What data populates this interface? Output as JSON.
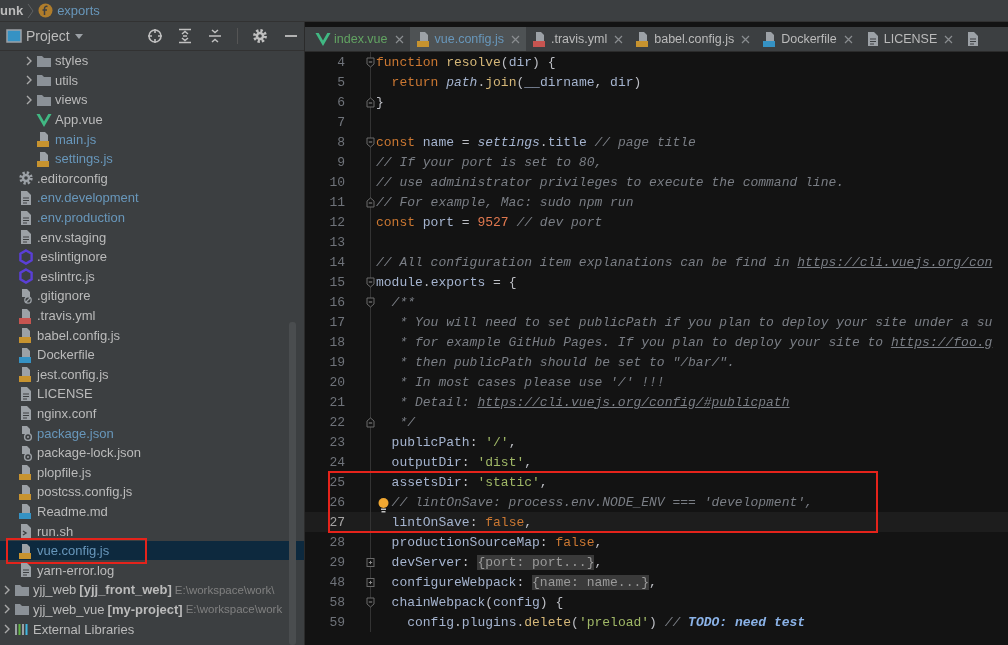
{
  "breadcrumb": [
    {
      "label": "unk",
      "kind": "text"
    },
    {
      "label": "exports",
      "kind": "function"
    }
  ],
  "project_panel": {
    "title": "Project",
    "tree": [
      {
        "children": [
          {
            "children": [
              {
                "label": "styles",
                "kind": "folder",
                "modified": false,
                "expanded": false,
                "selected": false,
                "annotated": false
              },
              {
                "label": "utils",
                "kind": "folder",
                "modified": false,
                "expanded": false,
                "selected": false,
                "annotated": false
              },
              {
                "label": "views",
                "kind": "folder",
                "modified": false,
                "expanded": false,
                "selected": false,
                "annotated": false
              },
              {
                "label": "App.vue",
                "kind": "vue",
                "modified": false,
                "selected": false,
                "annotated": false
              },
              {
                "label": "main.js",
                "kind": "js",
                "modified": true,
                "selected": false,
                "annotated": false
              },
              {
                "label": "settings.js",
                "kind": "js",
                "modified": true,
                "selected": false,
                "annotated": false
              }
            ]
          },
          {
            "label": ".editorconfig",
            "kind": "gear",
            "modified": false,
            "selected": false,
            "annotated": false
          },
          {
            "label": ".env.development",
            "kind": "plain",
            "modified": true,
            "selected": false,
            "annotated": false
          },
          {
            "label": ".env.production",
            "kind": "plain",
            "modified": true,
            "selected": false,
            "annotated": false
          },
          {
            "label": ".env.staging",
            "kind": "plain",
            "modified": false,
            "selected": false,
            "annotated": false
          },
          {
            "label": ".eslintignore",
            "kind": "eslint",
            "modified": false,
            "selected": false,
            "annotated": false
          },
          {
            "label": ".eslintrc.js",
            "kind": "eslint",
            "modified": false,
            "selected": false,
            "annotated": false
          },
          {
            "label": ".gitignore",
            "kind": "ignore",
            "modified": false,
            "selected": false,
            "annotated": false
          },
          {
            "label": ".travis.yml",
            "kind": "yml",
            "modified": false,
            "selected": false,
            "annotated": false
          },
          {
            "label": "babel.config.js",
            "kind": "js",
            "modified": false,
            "selected": false,
            "annotated": false
          },
          {
            "label": "Dockerfile",
            "kind": "docker",
            "modified": false,
            "selected": false,
            "annotated": false
          },
          {
            "label": "jest.config.js",
            "kind": "js",
            "modified": false,
            "selected": false,
            "annotated": false
          },
          {
            "label": "LICENSE",
            "kind": "plain",
            "modified": false,
            "selected": false,
            "annotated": false
          },
          {
            "label": "nginx.conf",
            "kind": "plain",
            "modified": false,
            "selected": false,
            "annotated": false
          },
          {
            "label": "package.json",
            "kind": "json",
            "modified": true,
            "selected": false,
            "annotated": false
          },
          {
            "label": "package-lock.json",
            "kind": "json",
            "modified": false,
            "selected": false,
            "annotated": false
          },
          {
            "label": "plopfile.js",
            "kind": "js",
            "modified": false,
            "selected": false,
            "annotated": false
          },
          {
            "label": "postcss.config.js",
            "kind": "js",
            "modified": false,
            "selected": false,
            "annotated": false
          },
          {
            "label": "Readme.md",
            "kind": "md",
            "modified": false,
            "selected": false,
            "annotated": false
          },
          {
            "label": "run.sh",
            "kind": "sh",
            "modified": false,
            "selected": false,
            "annotated": false
          },
          {
            "label": "vue.config.js",
            "kind": "js",
            "modified": true,
            "selected": true,
            "annotated": true
          },
          {
            "label": "yarn-error.log",
            "kind": "plain",
            "modified": false,
            "selected": false,
            "annotated": false
          }
        ]
      },
      {
        "label": "yjj_web",
        "module": "[yjj_front_web]",
        "path": "E:\\workspace\\work\\",
        "kind": "folder",
        "modified": false,
        "expanded": false,
        "selected": false,
        "annotated": false
      },
      {
        "label": "yjj_web_vue",
        "module": "[my-project]",
        "path": "E:\\workspace\\work",
        "kind": "folder",
        "modified": false,
        "expanded": false,
        "selected": false,
        "annotated": false
      },
      {
        "label": "External Libraries",
        "kind": "libraries",
        "modified": false,
        "expanded": false,
        "selected": false,
        "annotated": false
      }
    ]
  },
  "editor": {
    "tabs": [
      {
        "label": "index.vue",
        "kind": "vue",
        "added": true,
        "modified": false,
        "selected": false
      },
      {
        "label": "vue.config.js",
        "kind": "js",
        "added": false,
        "modified": true,
        "selected": true
      },
      {
        "label": ".travis.yml",
        "kind": "yml",
        "added": false,
        "modified": false,
        "selected": false
      },
      {
        "label": "babel.config.js",
        "kind": "js",
        "added": false,
        "modified": false,
        "selected": false
      },
      {
        "label": "Dockerfile",
        "kind": "docker",
        "added": false,
        "modified": false,
        "selected": false
      },
      {
        "label": "LICENSE",
        "kind": "plain",
        "added": false,
        "modified": false,
        "selected": false
      },
      {
        "kind": "plain",
        "selected": false
      }
    ],
    "lines": [
      {
        "number": "4",
        "fold": {
          "kind": "start"
        },
        "current": false,
        "annotated": false,
        "tokens": [
          {
            "kind": "kw",
            "text": "function "
          },
          {
            "kind": "fn",
            "text": "resolve"
          },
          {
            "kind": "p",
            "text": "("
          },
          {
            "kind": "id",
            "text": "dir"
          },
          {
            "kind": "p",
            "text": ") {"
          }
        ]
      },
      {
        "number": "5",
        "current": false,
        "annotated": false,
        "tokens": [
          {
            "kind": "kw",
            "text": "  return "
          },
          {
            "kind": "global",
            "text": "path"
          },
          {
            "kind": "p",
            "text": "."
          },
          {
            "kind": "fn",
            "text": "join"
          },
          {
            "kind": "p",
            "text": "("
          },
          {
            "kind": "id",
            "text": "__dirname"
          },
          {
            "kind": "p",
            "text": ", "
          },
          {
            "kind": "id",
            "text": "dir"
          },
          {
            "kind": "p",
            "text": ")"
          }
        ]
      },
      {
        "number": "6",
        "fold": {
          "kind": "end"
        },
        "current": false,
        "annotated": false,
        "tokens": [
          {
            "kind": "p",
            "text": "}"
          }
        ]
      },
      {
        "number": "7",
        "current": false,
        "annotated": false
      },
      {
        "number": "8",
        "fold": {
          "kind": "start"
        },
        "current": false,
        "annotated": false,
        "tokens": [
          {
            "kind": "kw",
            "text": "const "
          },
          {
            "kind": "id",
            "text": "name"
          },
          {
            "kind": "p",
            "text": " = "
          },
          {
            "kind": "global",
            "text": "settings"
          },
          {
            "kind": "p",
            "text": "."
          },
          {
            "kind": "id",
            "text": "title"
          },
          {
            "kind": "c",
            "text": " // page title"
          }
        ]
      },
      {
        "number": "9",
        "current": false,
        "annotated": false,
        "tokens": [
          {
            "kind": "c",
            "text": "// If your port is set to 80,"
          }
        ]
      },
      {
        "number": "10",
        "current": false,
        "annotated": false,
        "tokens": [
          {
            "kind": "c",
            "text": "// use administrator privileges to execute the command line."
          }
        ]
      },
      {
        "number": "11",
        "fold": {
          "kind": "end"
        },
        "current": false,
        "annotated": false,
        "tokens": [
          {
            "kind": "c",
            "text": "// For example, Mac: sudo npm run"
          }
        ]
      },
      {
        "number": "12",
        "current": false,
        "annotated": false,
        "tokens": [
          {
            "kind": "kw",
            "text": "const "
          },
          {
            "kind": "id",
            "text": "port"
          },
          {
            "kind": "p",
            "text": " = "
          },
          {
            "kind": "num",
            "text": "9527"
          },
          {
            "kind": "c",
            "text": " // dev port"
          }
        ]
      },
      {
        "number": "13",
        "current": false,
        "annotated": false
      },
      {
        "number": "14",
        "current": false,
        "annotated": false,
        "tokens": [
          {
            "kind": "c",
            "text": "// All configuration item explanations can be find in "
          },
          {
            "kind": "link",
            "text": "https://cli.vuejs.org/con"
          }
        ]
      },
      {
        "number": "15",
        "fold": {
          "kind": "start"
        },
        "current": false,
        "annotated": false,
        "tokens": [
          {
            "kind": "id",
            "text": "module"
          },
          {
            "kind": "p",
            "text": "."
          },
          {
            "kind": "id",
            "text": "exports"
          },
          {
            "kind": "p",
            "text": " = {"
          }
        ]
      },
      {
        "number": "16",
        "fold": {
          "kind": "start"
        },
        "current": false,
        "annotated": false,
        "tokens": [
          {
            "kind": "c",
            "text": "  /**"
          }
        ]
      },
      {
        "number": "17",
        "current": false,
        "annotated": false,
        "tokens": [
          {
            "kind": "c",
            "text": "   * You will need to set publicPath if you plan to deploy your site under a su"
          }
        ]
      },
      {
        "number": "18",
        "current": false,
        "annotated": false,
        "tokens": [
          {
            "kind": "c",
            "text": "   * for example GitHub Pages. If you plan to deploy your site to "
          },
          {
            "kind": "link",
            "text": "https://foo.g"
          }
        ]
      },
      {
        "number": "19",
        "current": false,
        "annotated": false,
        "tokens": [
          {
            "kind": "c",
            "text": "   * then publicPath should be set to \"/bar/\"."
          }
        ]
      },
      {
        "number": "20",
        "current": false,
        "annotated": false,
        "tokens": [
          {
            "kind": "c",
            "text": "   * In most cases please use '/' !!!"
          }
        ]
      },
      {
        "number": "21",
        "current": false,
        "annotated": false,
        "tokens": [
          {
            "kind": "c",
            "text": "   * Detail: "
          },
          {
            "kind": "link",
            "text": "https://cli.vuejs.org/config/#publicpath"
          }
        ]
      },
      {
        "number": "22",
        "fold": {
          "kind": "end"
        },
        "current": false,
        "annotated": false,
        "tokens": [
          {
            "kind": "c",
            "text": "   */"
          }
        ]
      },
      {
        "number": "23",
        "current": false,
        "annotated": false,
        "tokens": [
          {
            "kind": "id",
            "text": "  publicPath"
          },
          {
            "kind": "p",
            "text": ": "
          },
          {
            "kind": "str",
            "text": "'/'"
          },
          {
            "kind": "p",
            "text": ","
          }
        ]
      },
      {
        "number": "24",
        "current": false,
        "annotated": false,
        "tokens": [
          {
            "kind": "id",
            "text": "  outputDir"
          },
          {
            "kind": "p",
            "text": ": "
          },
          {
            "kind": "str",
            "text": "'dist'"
          },
          {
            "kind": "p",
            "text": ","
          }
        ]
      },
      {
        "number": "25",
        "current": false,
        "annotated": true,
        "tokens": [
          {
            "kind": "id",
            "text": "  assetsDir"
          },
          {
            "kind": "p",
            "text": ": "
          },
          {
            "kind": "str",
            "text": "'static'"
          },
          {
            "kind": "p",
            "text": ","
          }
        ]
      },
      {
        "number": "26",
        "current": false,
        "annotated": true,
        "bulb": true,
        "tokens": [
          {
            "kind": "c",
            "text": "  // lintOnSave: process.env.NODE_ENV === 'development',"
          }
        ]
      },
      {
        "number": "27",
        "current": true,
        "annotated": true,
        "tokens": [
          {
            "kind": "id",
            "text": "  lintOnSave"
          },
          {
            "kind": "p",
            "text": ": "
          },
          {
            "kind": "kw",
            "text": "false"
          },
          {
            "kind": "p",
            "text": ","
          }
        ]
      },
      {
        "number": "28",
        "current": false,
        "annotated": false,
        "tokens": [
          {
            "kind": "id",
            "text": "  productionSourceMap"
          },
          {
            "kind": "p",
            "text": ": "
          },
          {
            "kind": "kw",
            "text": "false"
          },
          {
            "kind": "p",
            "text": ","
          }
        ]
      },
      {
        "number": "29",
        "fold": {
          "kind": "collapsed"
        },
        "current": false,
        "annotated": false,
        "tokens": [
          {
            "kind": "id",
            "text": "  devServer"
          },
          {
            "kind": "p",
            "text": ": "
          },
          {
            "kind": "folded",
            "text": "{port: port...}"
          },
          {
            "kind": "p",
            "text": ","
          }
        ]
      },
      {
        "number": "48",
        "fold": {
          "kind": "collapsed"
        },
        "current": false,
        "annotated": false,
        "tokens": [
          {
            "kind": "id",
            "text": "  configureWebpack"
          },
          {
            "kind": "p",
            "text": ": "
          },
          {
            "kind": "folded",
            "text": "{name: name...}"
          },
          {
            "kind": "p",
            "text": ","
          }
        ]
      },
      {
        "number": "58",
        "fold": {
          "kind": "start"
        },
        "current": false,
        "annotated": false,
        "tokens": [
          {
            "kind": "id",
            "text": "  chainWebpack"
          },
          {
            "kind": "p",
            "text": "("
          },
          {
            "kind": "id",
            "text": "config"
          },
          {
            "kind": "p",
            "text": ") {"
          }
        ]
      },
      {
        "number": "59",
        "current": false,
        "annotated": false,
        "tokens": [
          {
            "kind": "id",
            "text": "    config"
          },
          {
            "kind": "p",
            "text": "."
          },
          {
            "kind": "id",
            "text": "plugins"
          },
          {
            "kind": "p",
            "text": "."
          },
          {
            "kind": "fn",
            "text": "delete"
          },
          {
            "kind": "p",
            "text": "("
          },
          {
            "kind": "str",
            "text": "'preload'"
          },
          {
            "kind": "p",
            "text": ") "
          },
          {
            "kind": "c",
            "text": "// "
          },
          {
            "kind": "todo",
            "text": "TODO: need test"
          }
        ]
      }
    ]
  }
}
